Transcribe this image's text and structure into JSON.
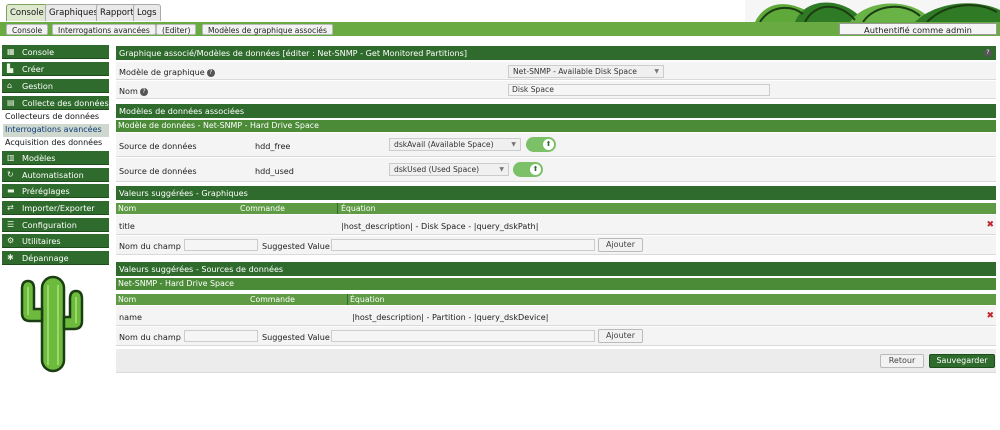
{
  "tabs": [
    {
      "label": "Console"
    },
    {
      "label": "Graphiques"
    },
    {
      "label": "Rapport"
    },
    {
      "label": "Logs"
    }
  ],
  "breadcrumb": [
    "Console",
    "Interrogations avancées",
    "(Editer)",
    "Modèles de graphique associés"
  ],
  "auth_label": "Authentifié comme admin",
  "sidebar": {
    "items": [
      {
        "label": "Console",
        "icon": "map-icon"
      },
      {
        "label": "Créer",
        "icon": "chart-icon"
      },
      {
        "label": "Gestion",
        "icon": "home-icon"
      },
      {
        "label": "Collecte des données",
        "icon": "database-icon"
      }
    ],
    "subitems": [
      "Collecteurs de données",
      "Interrogations avancées",
      "Acquisition des données"
    ],
    "items2": [
      {
        "label": "Modèles",
        "icon": "templates-icon"
      },
      {
        "label": "Automatisation",
        "icon": "sync-icon"
      },
      {
        "label": "Préréglages",
        "icon": "presets-icon"
      },
      {
        "label": "Importer/Exporter",
        "icon": "exchange-icon"
      },
      {
        "label": "Configuration",
        "icon": "sliders-icon"
      },
      {
        "label": "Utilitaires",
        "icon": "gears-icon"
      },
      {
        "label": "Dépannage",
        "icon": "bug-icon"
      }
    ]
  },
  "main": {
    "title": "Graphique associé/Modèles de données [éditer : Net-SNMP - Get Monitored Partitions]",
    "help": "?",
    "graph_template_label": "Modèle de graphique",
    "graph_template_value": "Net-SNMP - Available Disk Space",
    "name_label": "Nom",
    "name_value": "Disk Space",
    "dt_section": "Modèles de données associées",
    "dt_subheader": "Modèle de données - Net-SNMP - Hard Drive Space",
    "ds_rows": [
      {
        "label": "Source de données",
        "name": "hdd_free",
        "value": "dskAvail (Available Space)"
      },
      {
        "label": "Source de données",
        "name": "hdd_used",
        "value": "dskUsed (Used Space)"
      }
    ],
    "graph_sugg_title": "Valeurs suggérées - Graphiques",
    "graph_cols": {
      "name": "Nom",
      "command": "Commande",
      "equation": "Équation"
    },
    "graph_row": {
      "name": "title",
      "equation": "|host_description| - Disk Space - |query_dskPath|"
    },
    "field_name_label": "Nom du champ",
    "suggested_label": "Suggested Value",
    "add_label": "Ajouter",
    "ds_sugg_title": "Valeurs suggérées - Sources de données",
    "ds_sugg_sub": "Net-SNMP - Hard Drive Space",
    "ds_row": {
      "name": "name",
      "equation": "|host_description| - Partition - |query_dskDevice|"
    },
    "back_label": "Retour",
    "save_label": "Sauvegarder"
  }
}
